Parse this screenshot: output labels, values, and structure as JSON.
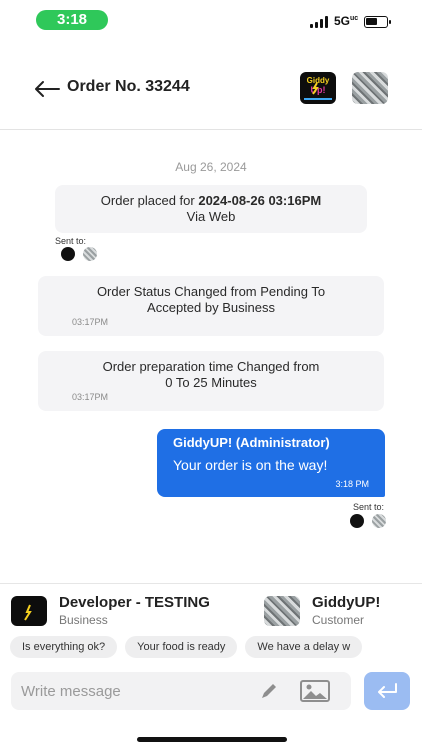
{
  "status_bar": {
    "time": "3:18",
    "network": "5G",
    "network_suffix": "uc"
  },
  "header": {
    "title": "Order No. 33244",
    "logo_lines": [
      "Giddy",
      "Up!"
    ]
  },
  "chat": {
    "date": "Aug 26, 2024",
    "order_placed": {
      "prefix": "Order placed for ",
      "datetime": "2024-08-26 03:16PM",
      "line2": "Via Web"
    },
    "sent_to_label": "Sent to:",
    "status_changed": {
      "line1": "Order Status Changed from Pending To",
      "line2": "Accepted by Business",
      "time": "03:17PM"
    },
    "prep_changed": {
      "line1": "Order preparation time Changed from",
      "line2": "0 To 25 Minutes",
      "time": "03:17PM"
    },
    "my_message": {
      "sender": "GiddyUP! (Administrator)",
      "text": "Your order is on the way!",
      "time": "3:18 PM"
    }
  },
  "parties": [
    {
      "name": "Developer - TESTING",
      "role": "Business"
    },
    {
      "name": "GiddyUP!",
      "role": "Customer"
    }
  ],
  "quick_replies": [
    "Is everything ok?",
    "Your food is ready",
    "We have a delay w"
  ],
  "composer": {
    "placeholder": "Write message"
  },
  "colors": {
    "accent": "#1f6fe5",
    "send": "#9bbcf2",
    "time_pill": "#2fc85a"
  }
}
